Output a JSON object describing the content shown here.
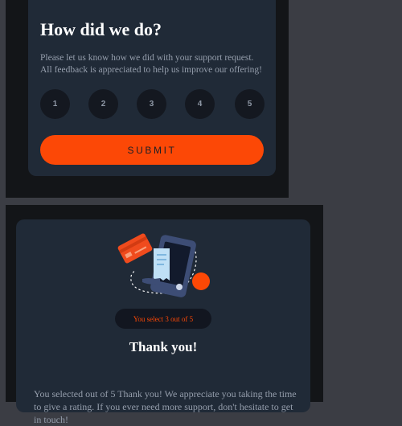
{
  "rating": {
    "title": "How did we do?",
    "description": "Please let us know how we did with your support request. All feedback is appreciated to help us improve our offering!",
    "options": [
      "1",
      "2",
      "3",
      "4",
      "5"
    ],
    "submit_label": "SUBMIT"
  },
  "thanks": {
    "selection_text": "You select 3 out of 5",
    "title": "Thank you!",
    "description": "You selected out of 5 Thank you! We appreciate you taking the time to give a rating. If you ever need more support, don't hesitate to get in touch!",
    "illustration_icon": "card-payment-phone-illustration"
  },
  "colors": {
    "accent": "#fc4806",
    "background": "#3b3d44",
    "frame": "#131518",
    "card": "#202a37",
    "rating_button": "#141820",
    "muted_text": "#959eac"
  }
}
